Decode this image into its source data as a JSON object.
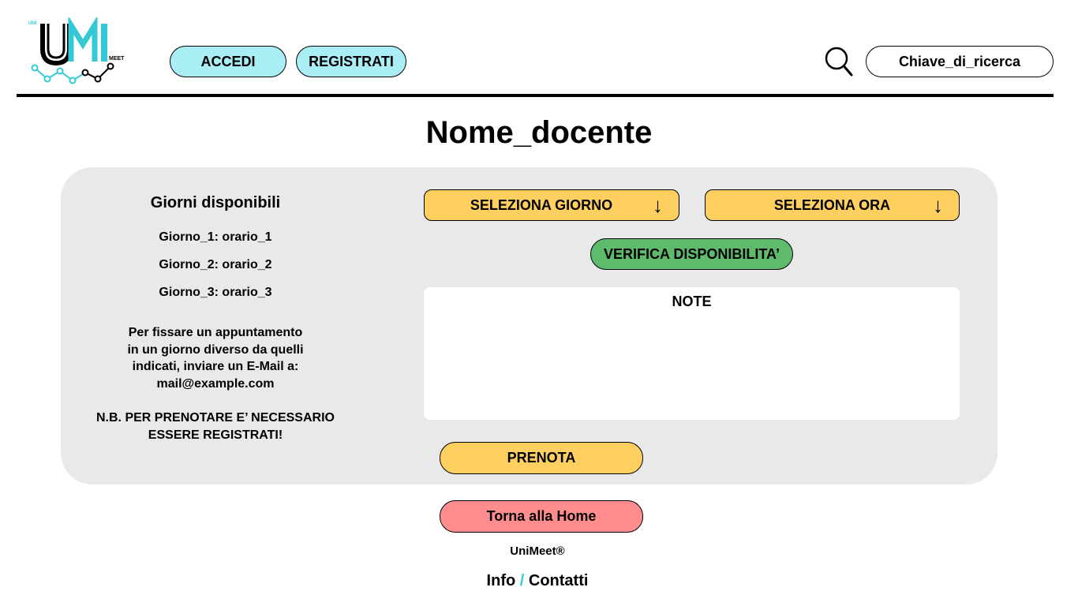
{
  "header": {
    "logo_letters": "UMI",
    "logo_top_text": "UNI",
    "logo_side_text": "MEET",
    "accedi_label": "ACCEDI",
    "registrati_label": "REGISTRATI",
    "search_placeholder": "Chiave_di_ricerca"
  },
  "page": {
    "title": "Nome_docente"
  },
  "availability": {
    "title": "Giorni disponibili",
    "slots": [
      "Giorno_1: orario_1",
      "Giorno_2: orario_2",
      "Giorno_3: orario_3"
    ],
    "info_lines": [
      "Per fissare un appuntamento",
      "in un giorno diverso da quelli",
      "indicati, inviare un E-Mail a:",
      "mail@example.com"
    ],
    "nb_lines": [
      "N.B. PER PRENOTARE E’ NECESSARIO",
      "ESSERE REGISTRATI!"
    ]
  },
  "booking": {
    "select_day_label": "SELEZIONA GIORNO",
    "select_hour_label": "SELEZIONA ORA",
    "arrow_glyph": "↓",
    "verify_label": "VERIFICA DISPONIBILITA’",
    "note_label": "NOTE",
    "book_label": "PRENOTA"
  },
  "footer": {
    "home_label": "Torna alla Home",
    "brand": "UniMeet®",
    "info_label": "Info",
    "separator": "/",
    "contacts_label": "Contatti"
  },
  "colors": {
    "cyan_button": "#a9eef5",
    "yellow_button": "#ffcf5f",
    "green_button": "#5fbb6c",
    "red_button": "#ff8d8d",
    "panel_bg": "#e9e9e9",
    "accent": "#35c9d6"
  }
}
